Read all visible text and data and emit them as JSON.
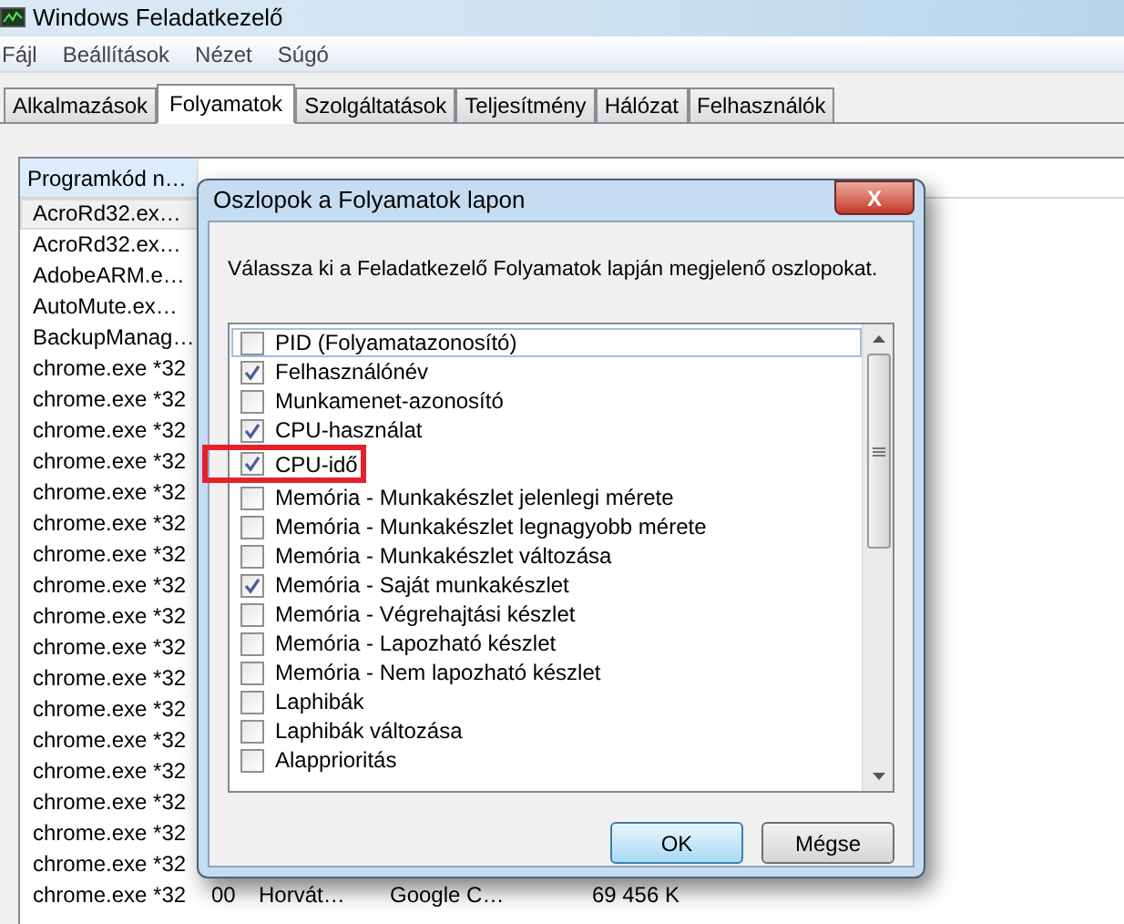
{
  "window": {
    "title": "Windows Feladatkezelő"
  },
  "menu": [
    "Fájl",
    "Beállítások",
    "Nézet",
    "Súgó"
  ],
  "tabs": [
    {
      "label": "Alkalmazások",
      "selected": false
    },
    {
      "label": "Folyamatok",
      "selected": true
    },
    {
      "label": "Szolgáltatások",
      "selected": false
    },
    {
      "label": "Teljesítmény",
      "selected": false
    },
    {
      "label": "Hálózat",
      "selected": false
    },
    {
      "label": "Felhasználók",
      "selected": false
    }
  ],
  "table": {
    "columns": [
      "Programkód n…"
    ],
    "rows": [
      {
        "cells": [
          "AcroRd32.ex…"
        ],
        "selected": true
      },
      {
        "cells": [
          "AcroRd32.ex…"
        ],
        "selected": false
      },
      {
        "cells": [
          "AdobeARM.e…"
        ],
        "selected": false
      },
      {
        "cells": [
          "AutoMute.ex…"
        ],
        "selected": false
      },
      {
        "cells": [
          "BackupManag…"
        ],
        "selected": false
      },
      {
        "cells": [
          "chrome.exe *32"
        ],
        "selected": false
      },
      {
        "cells": [
          "chrome.exe *32"
        ],
        "selected": false
      },
      {
        "cells": [
          "chrome.exe *32"
        ],
        "selected": false
      },
      {
        "cells": [
          "chrome.exe *32"
        ],
        "selected": false
      },
      {
        "cells": [
          "chrome.exe *32"
        ],
        "selected": false
      },
      {
        "cells": [
          "chrome.exe *32"
        ],
        "selected": false
      },
      {
        "cells": [
          "chrome.exe *32"
        ],
        "selected": false
      },
      {
        "cells": [
          "chrome.exe *32"
        ],
        "selected": false
      },
      {
        "cells": [
          "chrome.exe *32"
        ],
        "selected": false
      },
      {
        "cells": [
          "chrome.exe *32"
        ],
        "selected": false
      },
      {
        "cells": [
          "chrome.exe *32"
        ],
        "selected": false
      },
      {
        "cells": [
          "chrome.exe *32"
        ],
        "selected": false
      },
      {
        "cells": [
          "chrome.exe *32"
        ],
        "selected": false
      },
      {
        "cells": [
          "chrome.exe *32"
        ],
        "selected": false
      },
      {
        "cells": [
          "chrome.exe *32"
        ],
        "selected": false
      },
      {
        "cells": [
          "chrome.exe *32"
        ],
        "selected": false
      },
      {
        "cells": [
          "chrome.exe *32"
        ],
        "selected": false
      },
      {
        "cells": [
          "chrome.exe *32",
          "00",
          "Horvát…",
          "Google C…",
          "69 456 K"
        ],
        "selected": false
      }
    ]
  },
  "dialog": {
    "title": "Oszlopok a Folyamatok lapon",
    "close": "X",
    "prompt": "Válassza ki a Feladatkezelő Folyamatok lapján megjelenő oszlopokat.",
    "items": [
      {
        "label": "PID (Folyamatazonosító)",
        "checked": false,
        "selected": true,
        "highlighted": false
      },
      {
        "label": "Felhasználónév",
        "checked": true,
        "selected": false,
        "highlighted": false
      },
      {
        "label": "Munkamenet-azonosító",
        "checked": false,
        "selected": false,
        "highlighted": false
      },
      {
        "label": "CPU-használat",
        "checked": true,
        "selected": false,
        "highlighted": false
      },
      {
        "label": "CPU-idő",
        "checked": true,
        "selected": false,
        "highlighted": true
      },
      {
        "label": "Memória - Munkakészlet jelenlegi mérete",
        "checked": false,
        "selected": false,
        "highlighted": false
      },
      {
        "label": "Memória - Munkakészlet legnagyobb mérete",
        "checked": false,
        "selected": false,
        "highlighted": false
      },
      {
        "label": "Memória - Munkakészlet változása",
        "checked": false,
        "selected": false,
        "highlighted": false
      },
      {
        "label": "Memória - Saját munkakészlet",
        "checked": true,
        "selected": false,
        "highlighted": false
      },
      {
        "label": "Memória - Végrehajtási készlet",
        "checked": false,
        "selected": false,
        "highlighted": false
      },
      {
        "label": "Memória - Lapozható készlet",
        "checked": false,
        "selected": false,
        "highlighted": false
      },
      {
        "label": "Memória - Nem lapozható készlet",
        "checked": false,
        "selected": false,
        "highlighted": false
      },
      {
        "label": "Laphibák",
        "checked": false,
        "selected": false,
        "highlighted": false
      },
      {
        "label": "Laphibák változása",
        "checked": false,
        "selected": false,
        "highlighted": false
      },
      {
        "label": "Alapprioritás",
        "checked": false,
        "selected": false,
        "highlighted": false
      }
    ],
    "buttons": [
      "OK",
      "Mégse"
    ]
  }
}
